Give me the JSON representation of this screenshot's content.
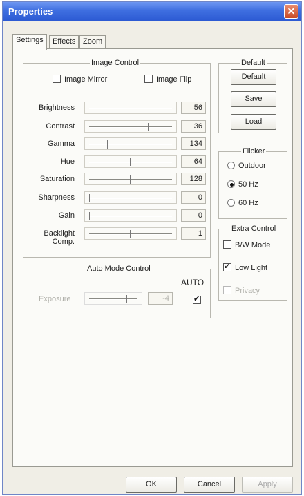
{
  "window": {
    "title": "Properties",
    "close_glyph": "✕"
  },
  "tabs": [
    {
      "label": "Settings",
      "active": true
    },
    {
      "label": "Effects",
      "active": false
    },
    {
      "label": "Zoom",
      "active": false
    }
  ],
  "image_control": {
    "legend": "Image Control",
    "mirror_label": "Image Mirror",
    "mirror_checked": false,
    "flip_label": "Image Flip",
    "flip_checked": false,
    "sliders": [
      {
        "label": "Brightness",
        "value": "56",
        "level": 0.15
      },
      {
        "label": "Contrast",
        "value": "36",
        "level": 0.72
      },
      {
        "label": "Gamma",
        "value": "134",
        "level": 0.22
      },
      {
        "label": "Hue",
        "value": "64",
        "level": 0.5
      },
      {
        "label": "Saturation",
        "value": "128",
        "level": 0.5
      },
      {
        "label": "Sharpness",
        "value": "0",
        "level": 0.0
      },
      {
        "label": "Gain",
        "value": "0",
        "level": 0.0
      },
      {
        "label": "Backlight Comp.",
        "value": "1",
        "level": 0.5
      }
    ]
  },
  "default_group": {
    "legend": "Default",
    "default_label": "Default",
    "save_label": "Save",
    "load_label": "Load"
  },
  "flicker": {
    "legend": "Flicker",
    "options": [
      {
        "label": "Outdoor",
        "selected": false
      },
      {
        "label": "50 Hz",
        "selected": true
      },
      {
        "label": "60 Hz",
        "selected": false
      }
    ]
  },
  "extra_control": {
    "legend": "Extra Control",
    "bw_label": "B/W Mode",
    "bw_checked": false,
    "lowlight_label": "Low Light",
    "lowlight_checked": true,
    "privacy_label": "Privacy",
    "privacy_checked": false
  },
  "auto_mode": {
    "legend": "Auto Mode Control",
    "auto_label": "AUTO",
    "auto_checked": true,
    "exposure_label": "Exposure",
    "exposure_value": "-4",
    "exposure_level": 0.8
  },
  "footer": {
    "ok_label": "OK",
    "cancel_label": "Cancel",
    "apply_label": "Apply"
  },
  "icons": {
    "close": "close-icon"
  }
}
